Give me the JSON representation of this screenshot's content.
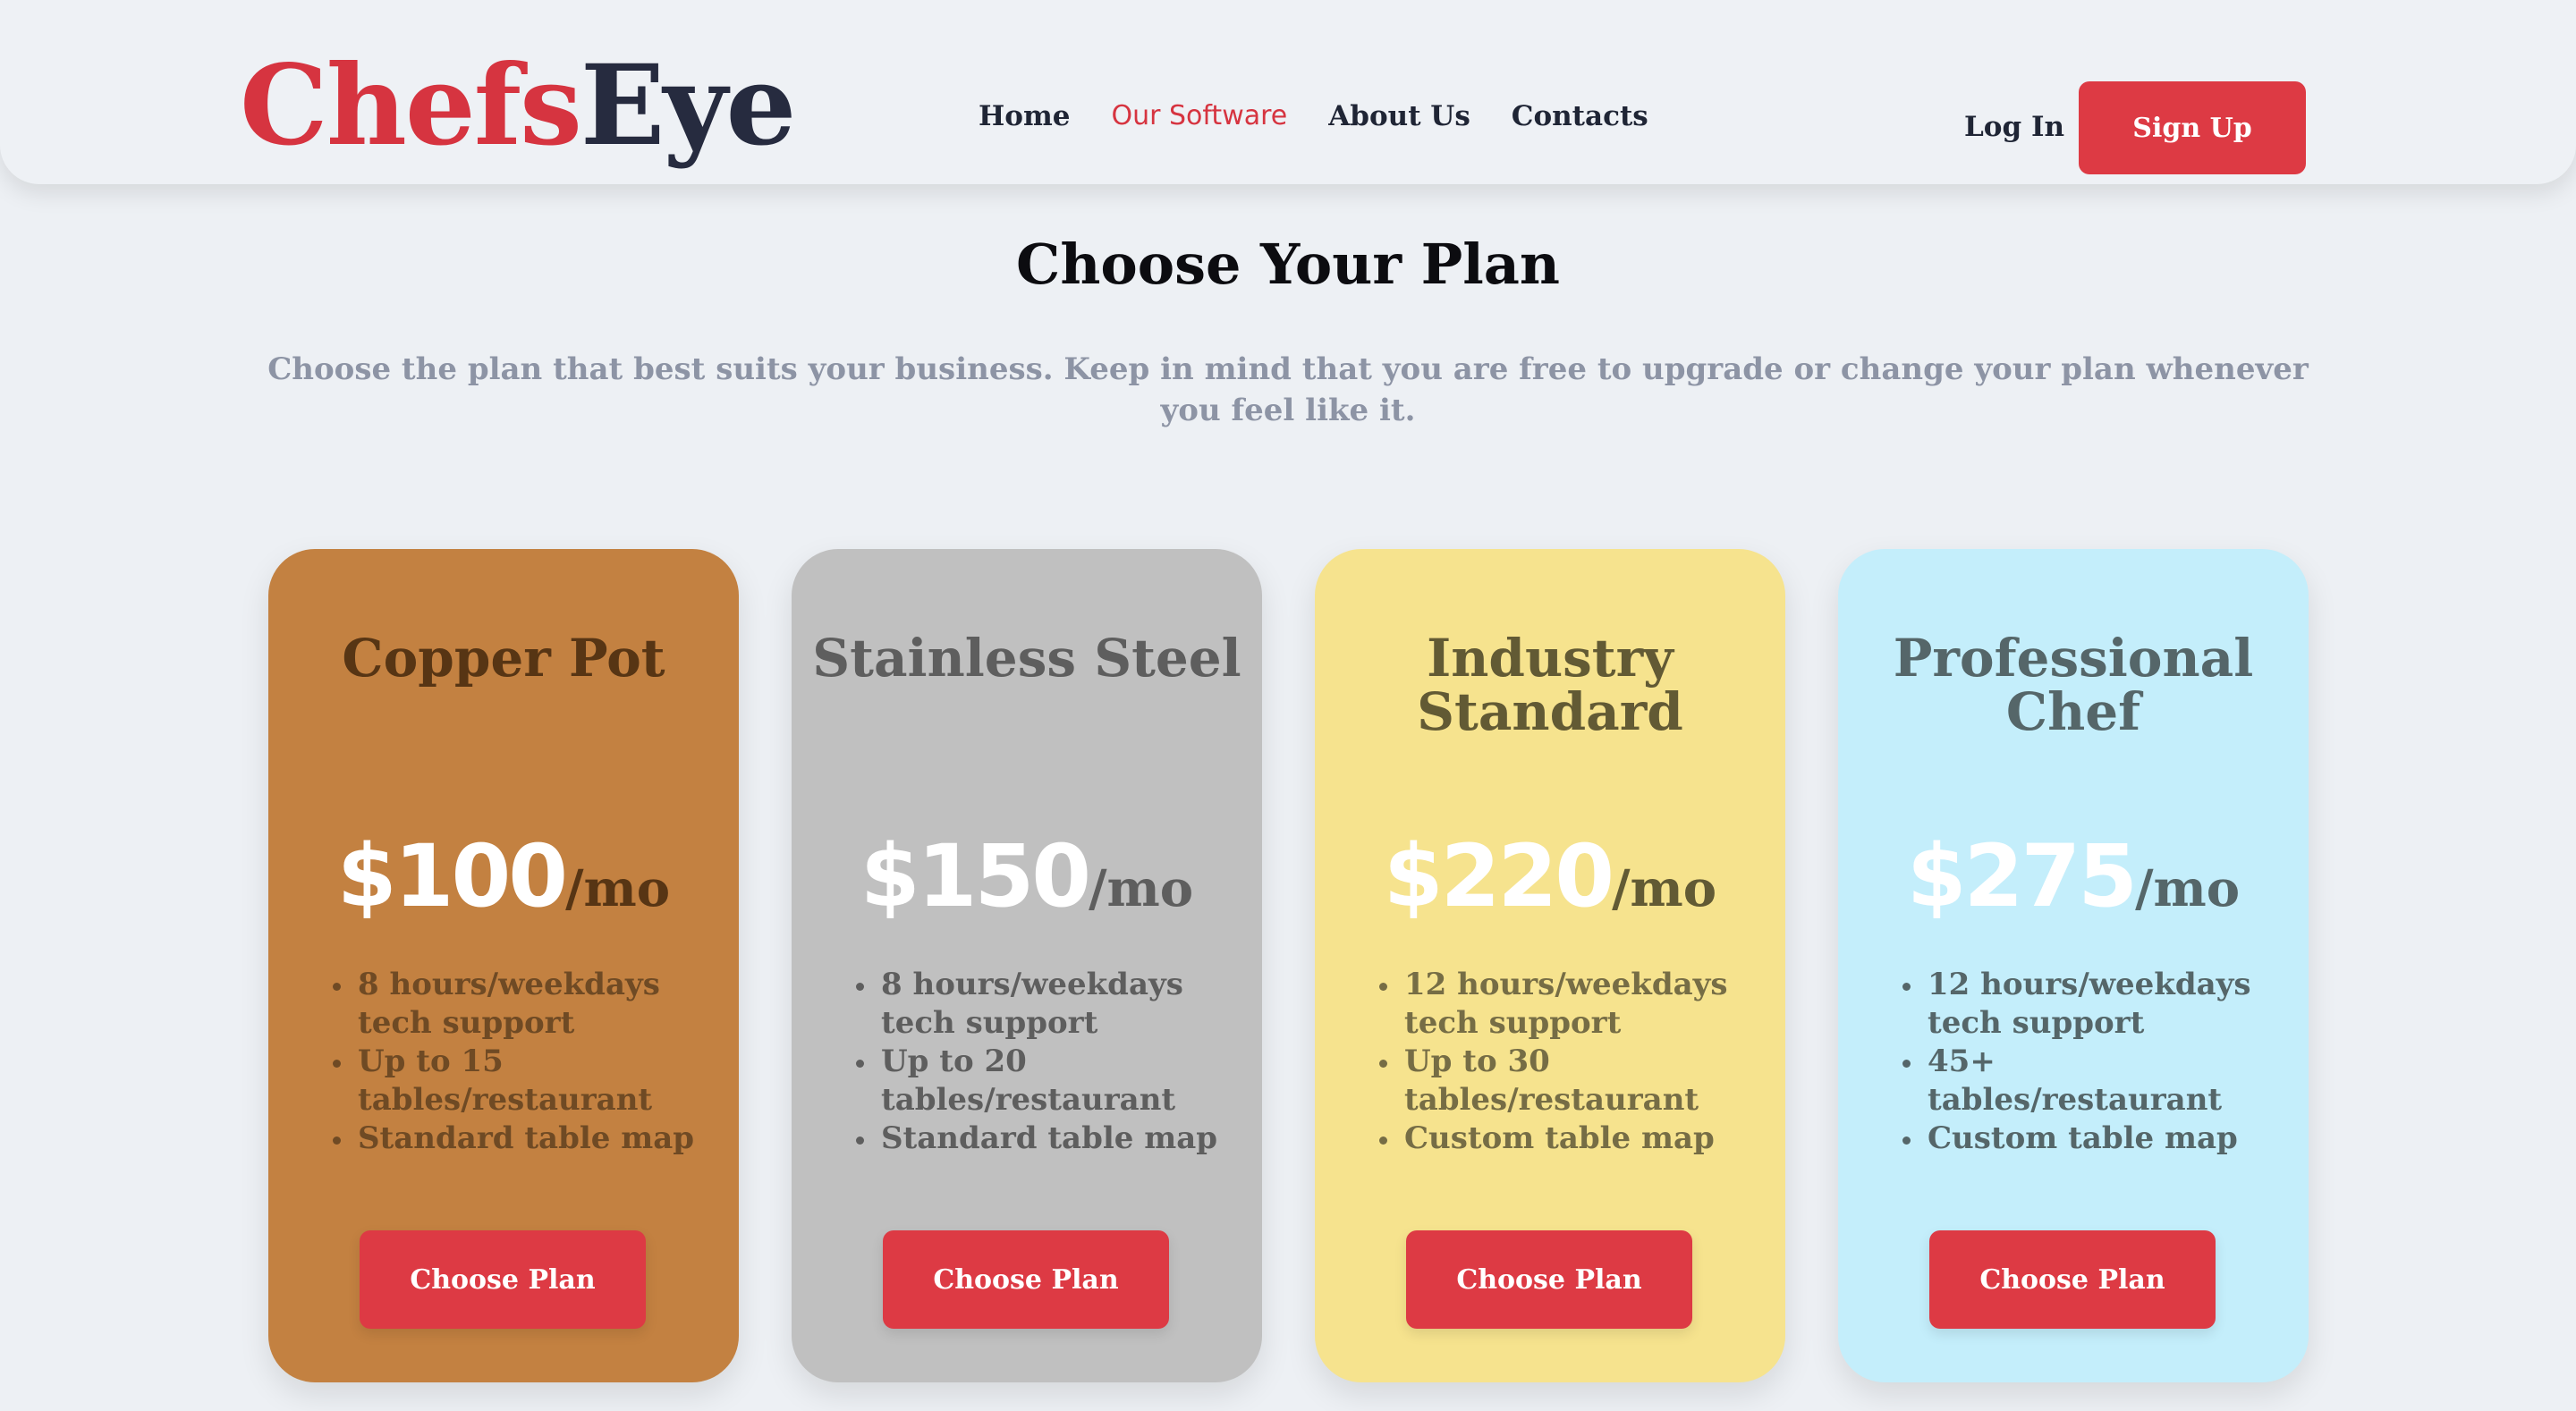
{
  "brand": {
    "logo_part1": "Chefs",
    "logo_part2": "Eye",
    "accent_color": "#d63440",
    "dark_color": "#262b3f"
  },
  "nav": {
    "items": [
      {
        "label": "Home",
        "active": false
      },
      {
        "label": "Our Software",
        "active": true
      },
      {
        "label": "About Us",
        "active": false
      },
      {
        "label": "Contacts",
        "active": false
      }
    ]
  },
  "auth": {
    "login_label": "Log In",
    "signup_label": "Sign Up"
  },
  "page": {
    "title": "Choose Your Plan",
    "subtitle": "Choose the plan that best suits your business. Keep in mind that you are free to upgrade or change your plan whenever you feel like it."
  },
  "plans": [
    {
      "name": "Copper Pot",
      "price": "$100",
      "period": "/mo",
      "color": "#c38141",
      "features": [
        "8 hours/weekdays tech support",
        "Up to 15 tables/restaurant",
        "Standard table map"
      ],
      "button_label": "Choose Plan"
    },
    {
      "name": "Stainless Steel",
      "price": "$150",
      "period": "/mo",
      "color": "#c0c0c0",
      "features": [
        "8 hours/weekdays tech support",
        "Up to 20 tables/restaurant",
        "Standard table map"
      ],
      "button_label": "Choose Plan"
    },
    {
      "name": "Industry Standard",
      "price": "$220",
      "period": "/mo",
      "color": "#f6e38e",
      "features": [
        "12 hours/weekdays tech support",
        "Up to 30 tables/restaurant",
        "Custom table map"
      ],
      "button_label": "Choose Plan"
    },
    {
      "name": "Professional Chef",
      "price": "$275",
      "period": "/mo",
      "color": "#c4eefb",
      "features": [
        "12 hours/weekdays tech support",
        "45+ tables/restaurant",
        "Custom table map"
      ],
      "button_label": "Choose Plan"
    }
  ]
}
